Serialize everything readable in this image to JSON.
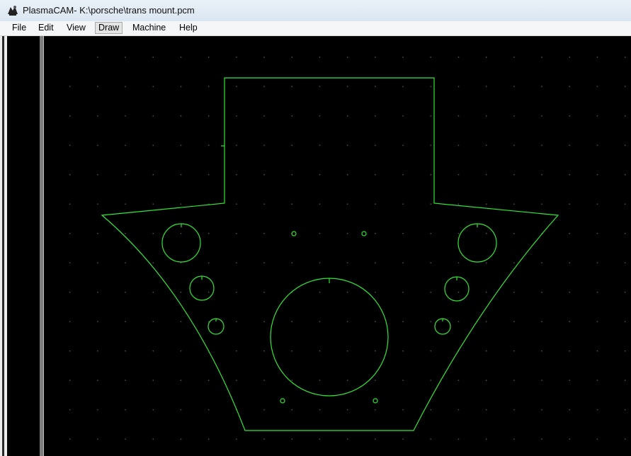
{
  "window": {
    "title": "PlasmaCAM- K:\\porsche\\trans mount.pcm",
    "icon": "plasmacam-app-icon"
  },
  "menu": {
    "items": [
      {
        "id": "file",
        "label": "File"
      },
      {
        "id": "edit",
        "label": "Edit"
      },
      {
        "id": "view",
        "label": "View"
      },
      {
        "id": "draw",
        "label": "Draw",
        "active": true
      },
      {
        "id": "machine",
        "label": "Machine"
      },
      {
        "id": "help",
        "label": "Help"
      }
    ]
  },
  "canvas": {
    "background": "#000000",
    "grid_dot_color": "#5a5a5a",
    "geometry_color": "#33e633",
    "ruler_color": "#7d7d7d"
  }
}
